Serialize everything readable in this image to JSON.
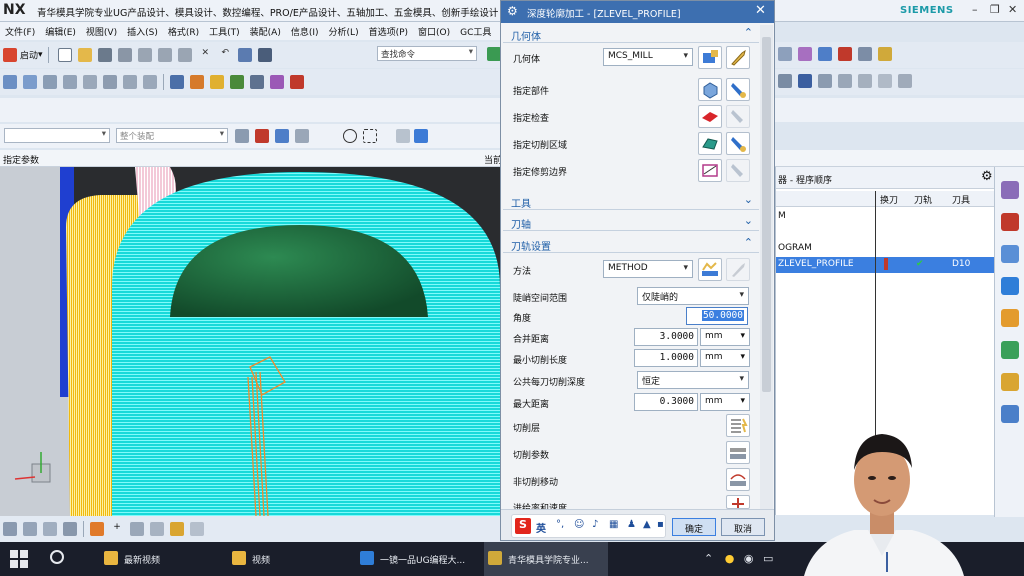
{
  "app": {
    "logo": "NX",
    "title": "青华模具学院专业UG产品设计、模具设计、数控编程、PRO/E产品设计、五轴加工、五金模具、创新手绘设计",
    "brand": "SIEMENS"
  },
  "menu": [
    "文件(F)",
    "编辑(E)",
    "视图(V)",
    "插入(S)",
    "格式(R)",
    "工具(T)",
    "装配(A)",
    "信息(I)",
    "分析(L)",
    "首选项(P)",
    "窗口(O)",
    "GC工具"
  ],
  "toolbar": {
    "start_label": "启动",
    "search_placeholder": "查找命令"
  },
  "filter": {
    "type_value": "",
    "scope_value": "整个装配"
  },
  "cue": {
    "left_text": "指定参数",
    "right_text": "当前"
  },
  "dialog": {
    "title": "深度轮廓加工 - [ZLEVEL_PROFILE]",
    "sections": {
      "geometry": "几何体",
      "tool": "工具",
      "axis": "刀轴",
      "path_settings": "刀轨设置"
    },
    "geometry": {
      "label": "几何体",
      "value": "MCS_MILL",
      "specify_part": "指定部件",
      "specify_check": "指定检查",
      "specify_cut_area": "指定切削区域",
      "specify_trim": "指定修剪边界"
    },
    "path": {
      "method_label": "方法",
      "method_value": "METHOD",
      "steep_label": "陡峭空间范围",
      "steep_value": "仅陡峭的",
      "angle_label": "角度",
      "angle_value": "50.0000",
      "merge_label": "合并距离",
      "merge_value": "3.0000",
      "merge_unit": "mm",
      "min_cut_label": "最小切削长度",
      "min_cut_value": "1.0000",
      "min_cut_unit": "mm",
      "depth_label": "公共每刀切削深度",
      "depth_value": "恒定",
      "max_dist_label": "最大距离",
      "max_dist_value": "0.3000",
      "max_dist_unit": "mm",
      "cut_levels": "切削层",
      "cut_params": "切削参数",
      "non_cut": "非切削移动",
      "feeds": "进给率和速度"
    },
    "ok": "确定",
    "cancel": "取消",
    "ime": "英"
  },
  "navigator": {
    "title": "器 - 程序顺序",
    "columns": [
      "换刀",
      "刀轨",
      "刀具"
    ],
    "rows": [
      {
        "name": "M"
      },
      {
        "name": "OGRAM"
      },
      {
        "name": "ZLEVEL_PROFILE",
        "tool": "D10",
        "status": "✔"
      }
    ]
  },
  "taskbar": {
    "items": [
      "最新视频",
      "视频",
      "一镜一品UG编程大...",
      "青华模具学院专业..."
    ]
  },
  "colors": {
    "dialog_title_bg": "#3d6fb0",
    "section_text": "#1f5fa8",
    "selection": "#3b7fe0",
    "toolpath_cyan": "#19e6e6",
    "dome_green": "#1f6a3e",
    "toolpath_yellow": "#f2c21c"
  }
}
